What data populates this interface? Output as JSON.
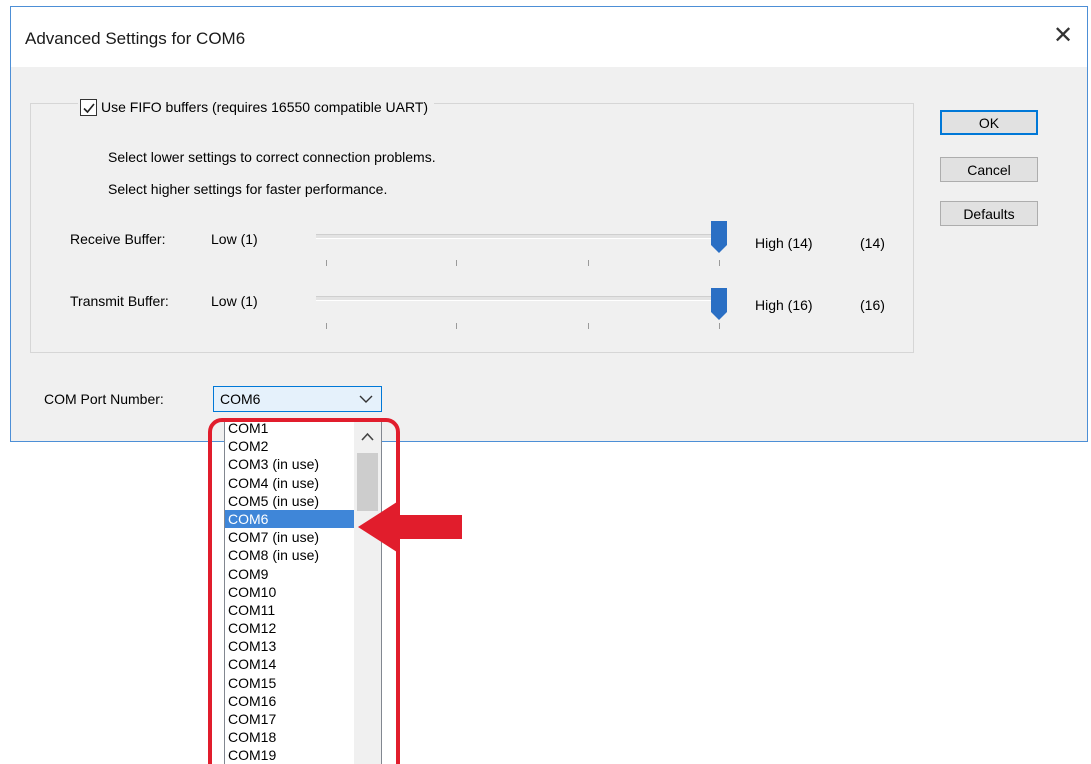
{
  "dialog": {
    "title": "Advanced Settings for COM6",
    "close_glyph": "✕"
  },
  "fifo": {
    "checked": true,
    "label": "Use FIFO buffers (requires 16550 compatible UART)"
  },
  "hints": {
    "lower": "Select lower settings to correct connection problems.",
    "higher": "Select higher settings for faster performance."
  },
  "receive": {
    "label": "Receive Buffer:",
    "low": "Low (1)",
    "high": "High (14)",
    "value_display": "(14)",
    "value": 14,
    "min": 1,
    "max": 14
  },
  "transmit": {
    "label": "Transmit Buffer:",
    "low": "Low (1)",
    "high": "High (16)",
    "value_display": "(16)",
    "value": 16,
    "min": 1,
    "max": 16
  },
  "buttons": {
    "ok": "OK",
    "cancel": "Cancel",
    "defaults": "Defaults"
  },
  "com_port": {
    "label": "COM Port Number:",
    "selected": "COM6",
    "options": [
      "COM1",
      "COM2",
      "COM3 (in use)",
      "COM4 (in use)",
      "COM5 (in use)",
      "COM6",
      "COM7 (in use)",
      "COM8 (in use)",
      "COM9",
      "COM10",
      "COM11",
      "COM12",
      "COM13",
      "COM14",
      "COM15",
      "COM16",
      "COM17",
      "COM18",
      "COM19"
    ],
    "selected_index": 5
  },
  "colors": {
    "accent": "#0078d7",
    "selection": "#3f86d8",
    "slider_thumb": "#2a6fc4",
    "annotation": "#e11d2c"
  },
  "icons": {
    "close": "close-icon",
    "check": "checkmark-icon",
    "dropdown": "chevron-down-icon",
    "scroll_up": "chevron-up-icon",
    "annotation_arrow": "left-arrow-icon"
  }
}
